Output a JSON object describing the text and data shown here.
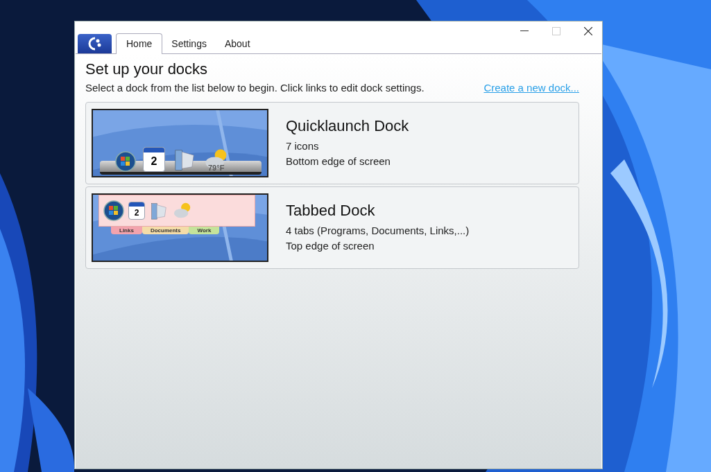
{
  "window": {
    "tabs": [
      {
        "label": "Home",
        "selected": true
      },
      {
        "label": "Settings",
        "selected": false
      },
      {
        "label": "About",
        "selected": false
      }
    ]
  },
  "heading": "Set up your docks",
  "intro": "Select a dock from the list below to begin. Click links to edit dock settings.",
  "create_link": "Create a new dock...",
  "docks": [
    {
      "name": "Quicklaunch Dock",
      "details": [
        "7 icons",
        "Bottom edge of screen"
      ],
      "preview": {
        "kind": "bottom",
        "calendar_day": "2",
        "weather": "79°F"
      }
    },
    {
      "name": "Tabbed Dock",
      "details": [
        "4 tabs (Programs, Documents, Links,...)",
        "Top edge of screen"
      ],
      "preview": {
        "kind": "tabbed",
        "calendar_day": "2",
        "tabs": [
          {
            "label": "Links",
            "color": "#f3a3ad"
          },
          {
            "label": "Documents",
            "color": "#f4dca8"
          },
          {
            "label": "Work",
            "color": "#c5e39a"
          }
        ]
      }
    }
  ]
}
